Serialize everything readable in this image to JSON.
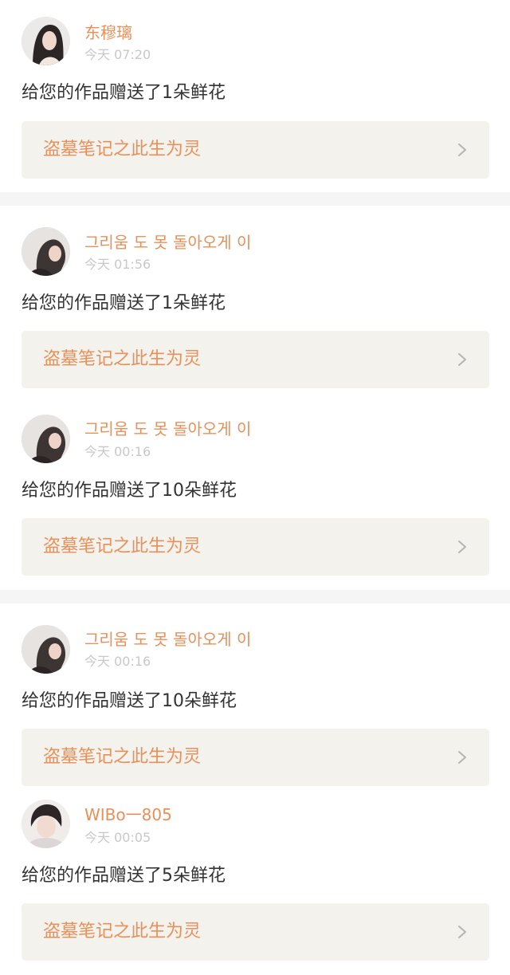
{
  "notifications": [
    {
      "username": "东穆璃",
      "time": "今天 07:20",
      "message": "给您的作品赠送了1朵鲜花",
      "work_title": "盗墓笔记之此生为灵",
      "avatar_icon": "girl-portrait-avatar"
    },
    {
      "username": "그리움 도 못 돌아오게 이",
      "time": "今天 01:56",
      "message": "给您的作品赠送了1朵鲜花",
      "work_title": "盗墓笔记之此生为灵",
      "avatar_icon": "profile-portrait-avatar"
    },
    {
      "username": "그리움 도 못 돌아오게 이",
      "time": "今天 00:16",
      "message": "给您的作品赠送了10朵鲜花",
      "work_title": "盗墓笔记之此生为灵",
      "avatar_icon": "profile-portrait-avatar"
    },
    {
      "username": "그리움 도 못 돌아오게 이",
      "time": "今天 00:16",
      "message": "给您的作品赠送了10朵鲜花",
      "work_title": "盗墓笔记之此生为灵",
      "avatar_icon": "profile-portrait-avatar"
    },
    {
      "username": "WIBo一805",
      "time": "今天 00:05",
      "message": "给您的作品赠送了5朵鲜花",
      "work_title": "盗墓笔记之此生为灵",
      "avatar_icon": "boy-portrait-avatar"
    }
  ],
  "colors": {
    "accent": "#e8905a",
    "card_background": "#f4f2ed",
    "separator": "#f5f5f5",
    "time_text": "#c8c8c8",
    "message_text": "#333333"
  }
}
